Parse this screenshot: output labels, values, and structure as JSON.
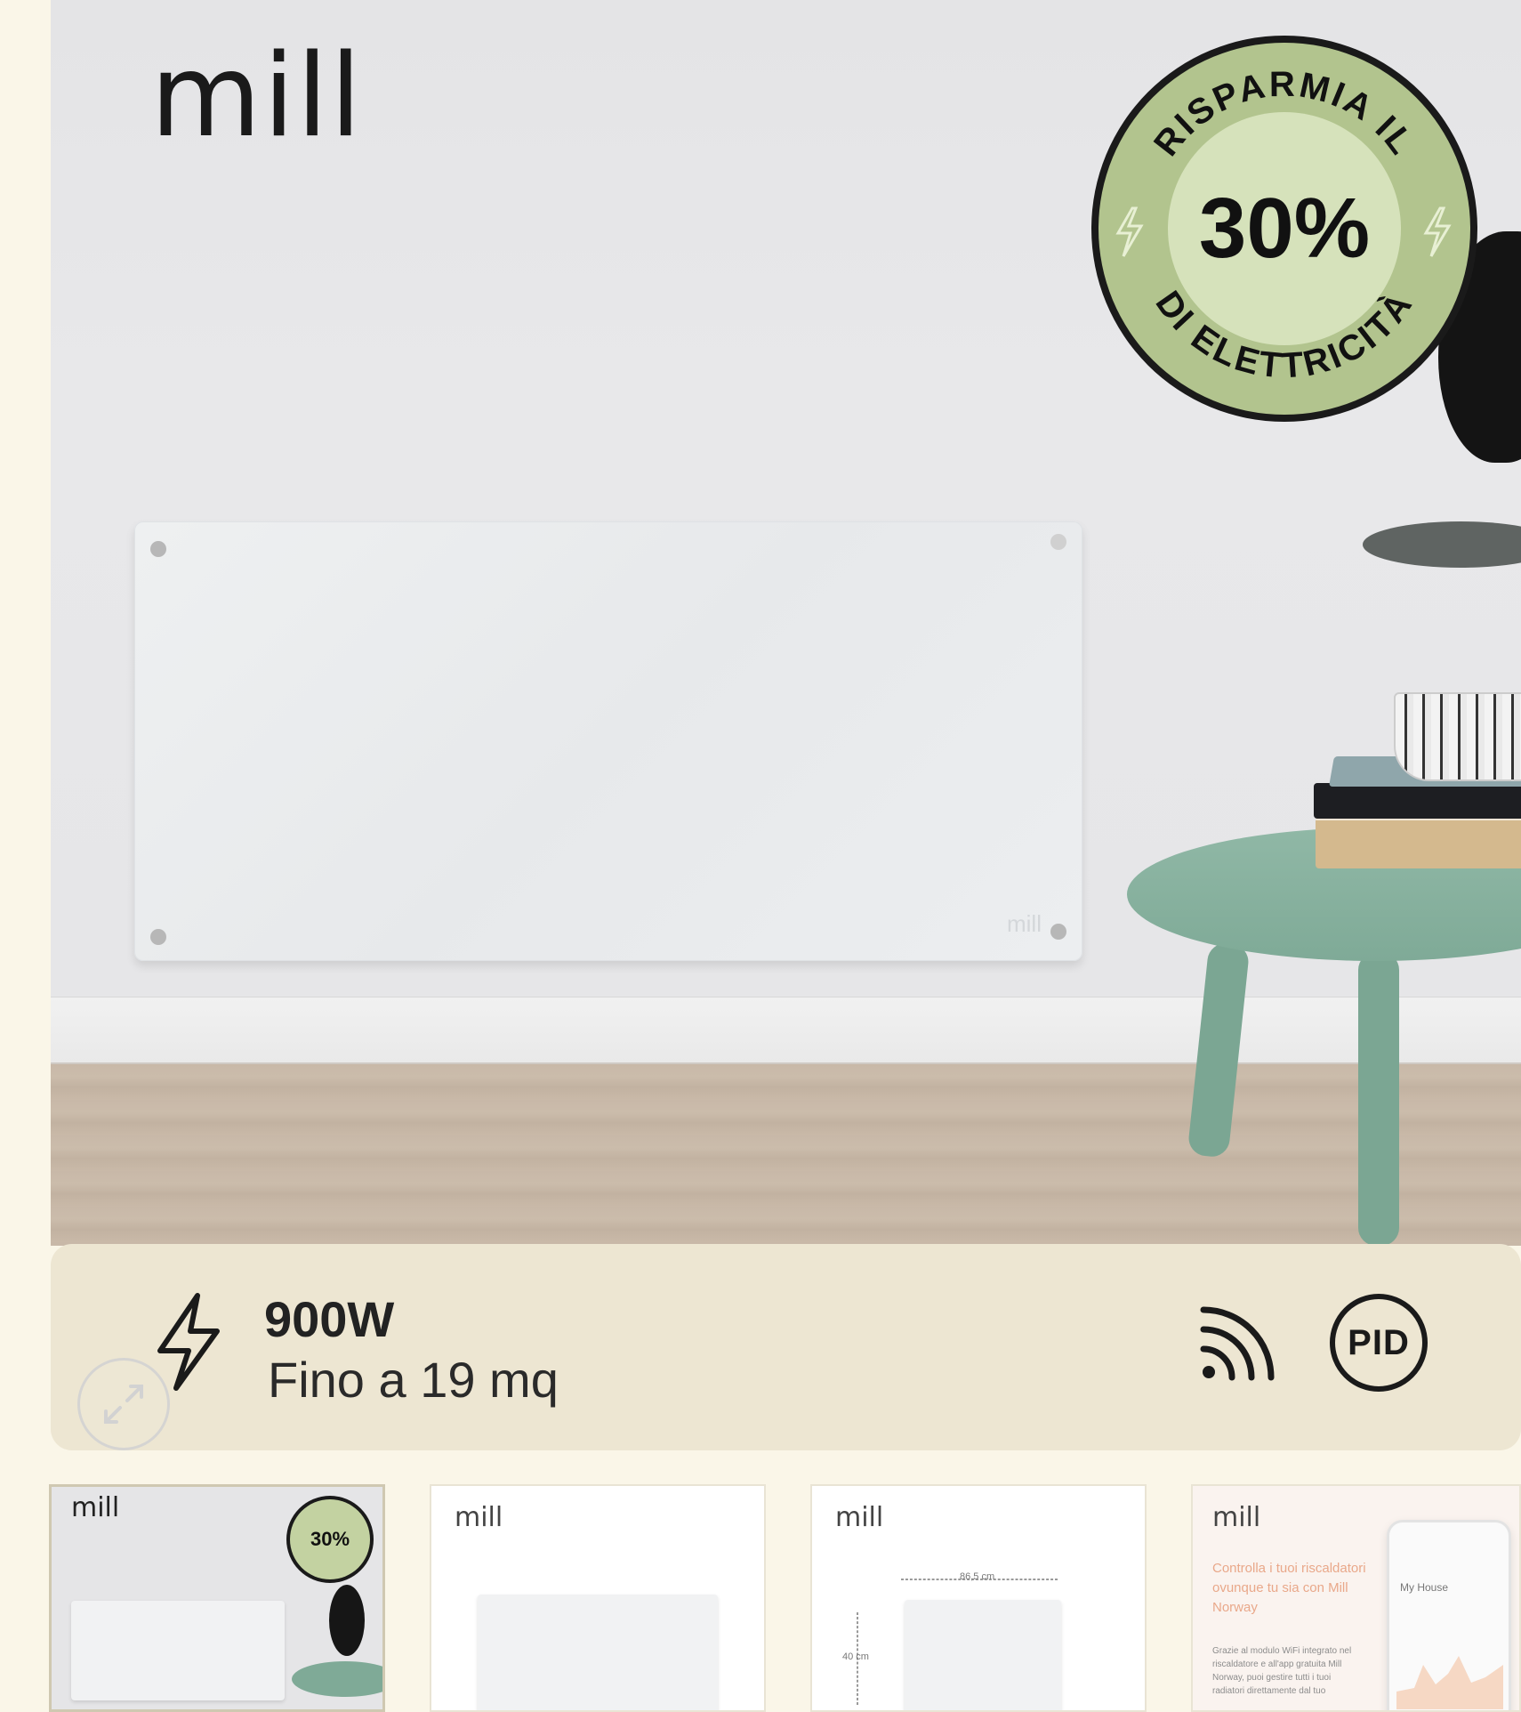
{
  "hero": {
    "brand": "mill",
    "badge": {
      "top_text": "RISPARMIA IL",
      "percent": "30%",
      "bottom_text": "DI ELETTRICITÀ"
    },
    "radiator_mark": "mill"
  },
  "specs": {
    "power": "900W",
    "area": "Fino a 19 mq",
    "pid_label": "PID",
    "icons": [
      "lightning-bolt-icon",
      "expand-icon",
      "wifi-icon",
      "pid-icon"
    ]
  },
  "thumbnails": [
    {
      "logo": "mill",
      "badge_percent": "30%"
    },
    {
      "logo": "mill"
    },
    {
      "logo": "mill",
      "width_label": "86,5 cm",
      "height_label": "40 cm"
    },
    {
      "logo": "mill",
      "headline": "Controlla i tuoi riscaldatori ovunque tu sia con Mill Norway",
      "body": "Grazie al modulo WiFi integrato nel riscaldatore e all'app gratuita Mill Norway, puoi gestire tutti i tuoi radiatori direttamente dal tuo",
      "phone_title": "My House"
    }
  ],
  "colors": {
    "page_bg": "#faf6e8",
    "spec_bar_bg": "#ede6d2",
    "badge_green": "#b2c48e",
    "badge_center": "#d6e2bb",
    "table_green": "#7faa97"
  }
}
